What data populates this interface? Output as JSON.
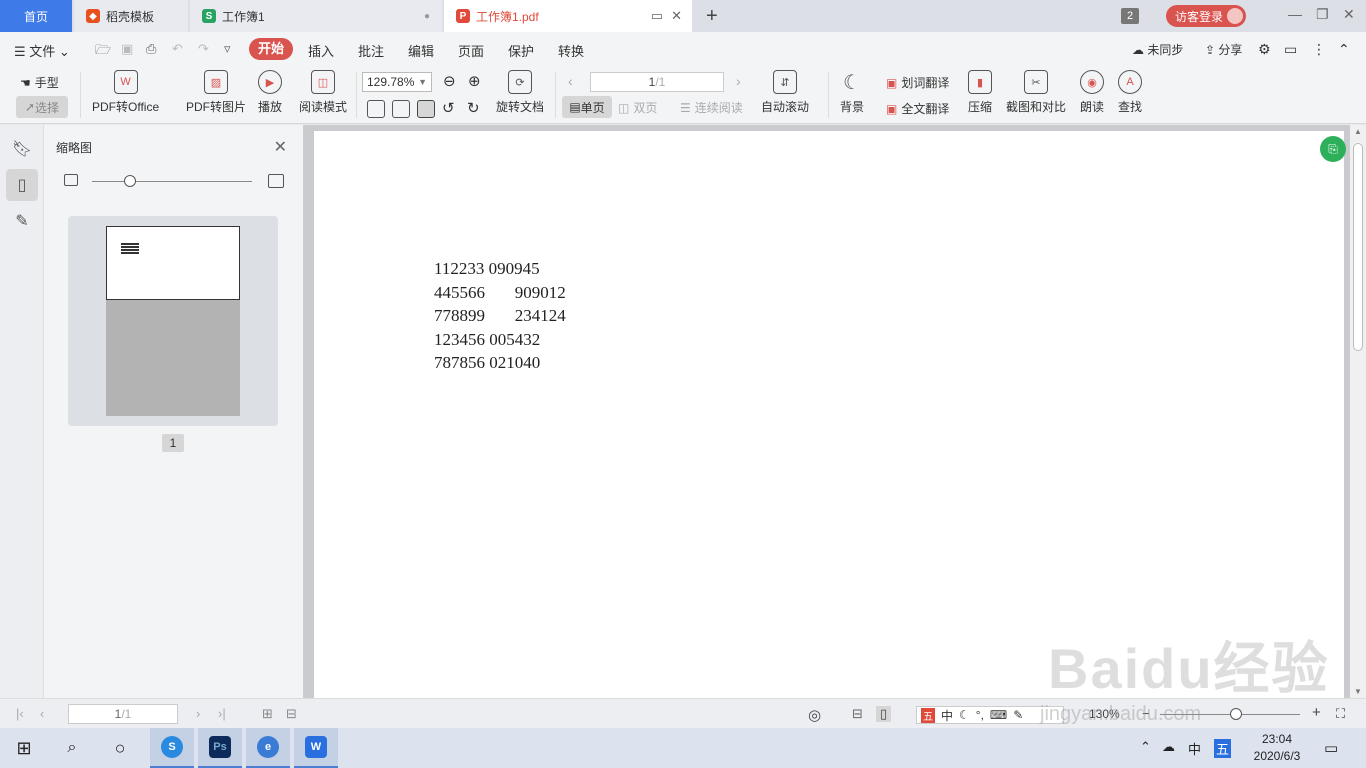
{
  "tabs": {
    "home": "首页",
    "daoke": "稻壳模板",
    "book": "工作簿1",
    "pdf": "工作簿1.pdf",
    "window_count": "2",
    "login": "访客登录"
  },
  "menu": {
    "file": "文件",
    "items": [
      "开始",
      "插入",
      "批注",
      "编辑",
      "页面",
      "保护",
      "转换"
    ],
    "sync": "未同步",
    "share": "分享"
  },
  "ribbon": {
    "hand": "手型",
    "select": "选择",
    "pdf_to_office": "PDF转Office",
    "pdf_to_image": "PDF转图片",
    "play": "播放",
    "read_mode": "阅读模式",
    "zoom": "129.78%",
    "rotate_doc": "旋转文档",
    "page_input": "1",
    "page_total": "/1",
    "single": "单页",
    "double": "双页",
    "continuous": "连续阅读",
    "auto_scroll": "自动滚动",
    "background": "背景",
    "word_translate": "划词翻译",
    "full_translate": "全文翻译",
    "compress": "压缩",
    "screenshot_compare": "截图和对比",
    "read_aloud": "朗读",
    "find": "查找"
  },
  "thumbs": {
    "title": "缩略图",
    "page_label": "1"
  },
  "document": {
    "rows": [
      "112233 090945",
      "445566       909012",
      "778899       234124",
      "123456 005432",
      "787856 021040"
    ]
  },
  "status": {
    "page_input": "1",
    "page_total": "/1",
    "zoom": "130%"
  },
  "taskbar": {
    "ime_lang": "中",
    "ime_mode": "五",
    "time": "23:04",
    "date": "2020/6/3"
  },
  "watermark": {
    "brand": "Baidu经验",
    "url": "jingyan.baidu.com"
  },
  "colors": {
    "accent_red": "#d9534f",
    "home_tab_blue": "#3e7be8",
    "float_green": "#2eb05a"
  }
}
